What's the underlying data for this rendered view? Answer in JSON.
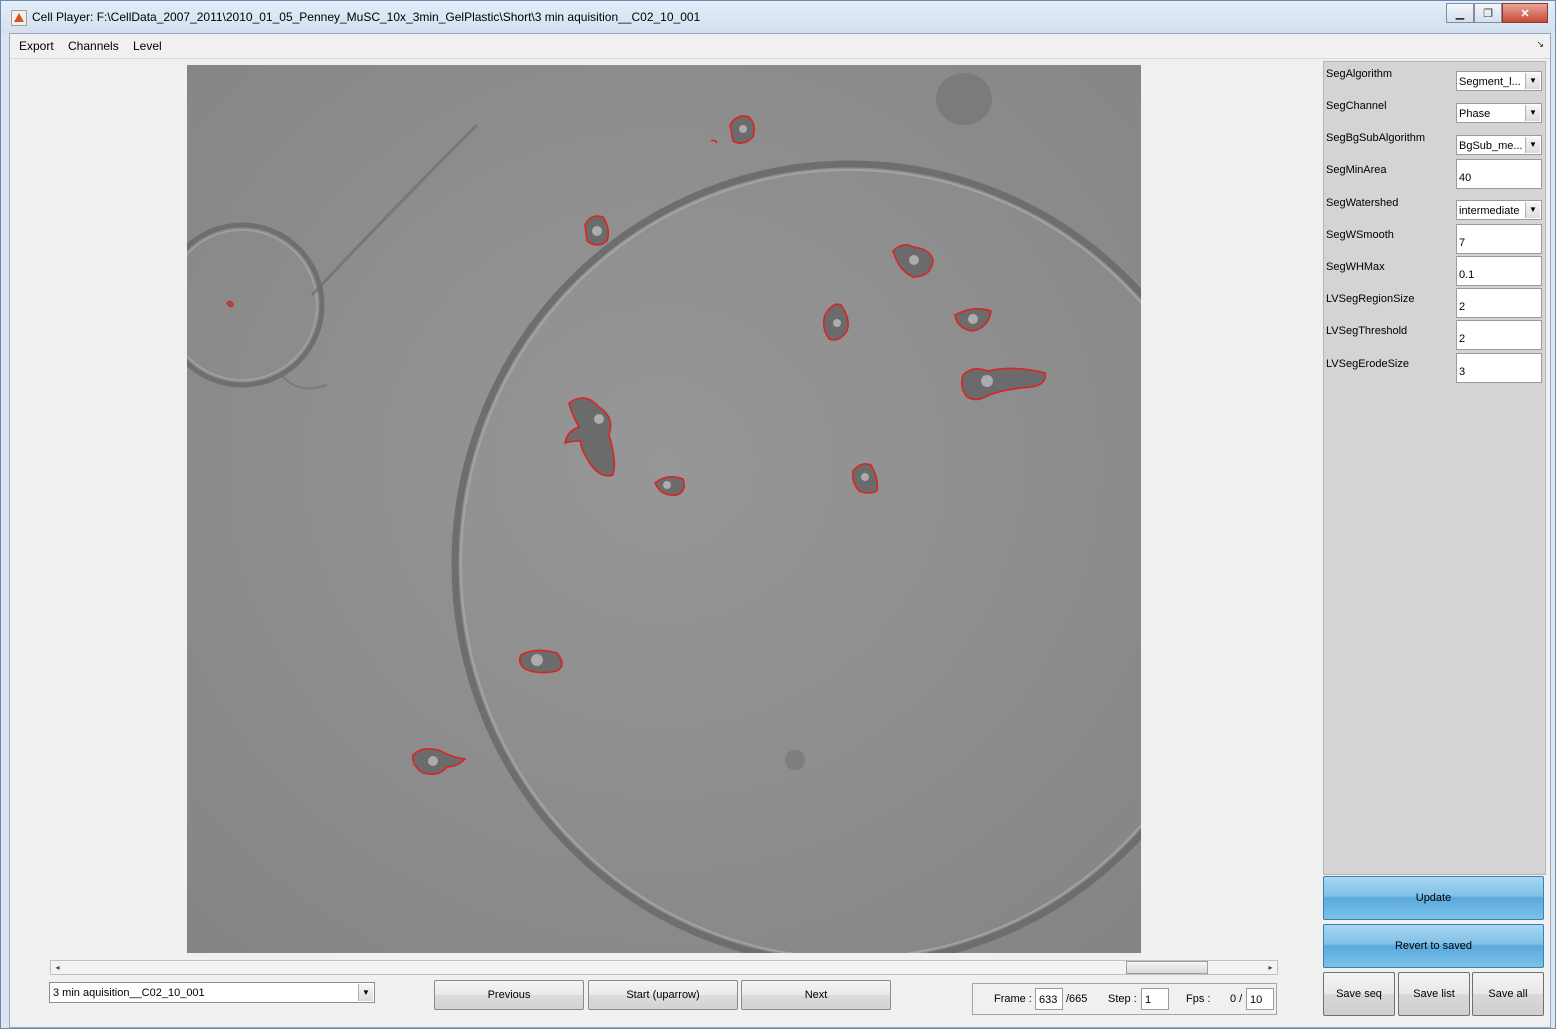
{
  "window": {
    "title": "Cell Player: F:\\CellData_2007_2011\\2010_01_05_Penney_MuSC_10x_3min_GelPlastic\\Short\\3 min aquisition__C02_10_001",
    "controls": [
      "minimize-icon",
      "restore-icon",
      "close-icon"
    ],
    "minimize_glyph": "▁",
    "restore_glyph": "❐",
    "close_glyph": "✕"
  },
  "menu": {
    "items": [
      "Export",
      "Channels",
      "Level"
    ],
    "corner_glyph": "↘"
  },
  "image": {
    "description_icon": "cell-microscopy-image",
    "outline_color": "#e02020"
  },
  "params": [
    {
      "label": "SegAlgorithm",
      "type": "select",
      "value": "Segment_l..."
    },
    {
      "label": "SegChannel",
      "type": "select",
      "value": "Phase"
    },
    {
      "label": "SegBgSubAlgorithm",
      "type": "select",
      "value": "BgSub_me..."
    },
    {
      "label": "SegMinArea",
      "type": "input",
      "value": "40"
    },
    {
      "label": "SegWatershed",
      "type": "select",
      "value": "intermediate"
    },
    {
      "label": "SegWSmooth",
      "type": "input",
      "value": "7"
    },
    {
      "label": "SegWHMax",
      "type": "input",
      "value": "0.1"
    },
    {
      "label": "LVSegRegionSize",
      "type": "input",
      "value": "2"
    },
    {
      "label": "LVSegThreshold",
      "type": "input",
      "value": "2"
    },
    {
      "label": "LVSegErodeSize",
      "type": "input",
      "value": "3"
    }
  ],
  "buttons": {
    "update": "Update",
    "revert": "Revert to saved",
    "save_seq": "Save seq",
    "save_list": "Save list",
    "save_all": "Save all",
    "previous": "Previous",
    "start": "Start (uparrow)",
    "next": "Next"
  },
  "sequence": {
    "selected": "3 min aquisition__C02_10_001"
  },
  "playback": {
    "frame_label": "Frame :",
    "frame_value": "633",
    "frame_total": "/665",
    "step_label": "Step :",
    "step_value": "1",
    "fps_label": "Fps :",
    "fps_current": "0 /",
    "fps_value": "10"
  },
  "slider": {
    "left_arrow": "◂",
    "right_arrow": "▸",
    "position_fraction": 0.95
  },
  "dropdown_arrow": "▼"
}
